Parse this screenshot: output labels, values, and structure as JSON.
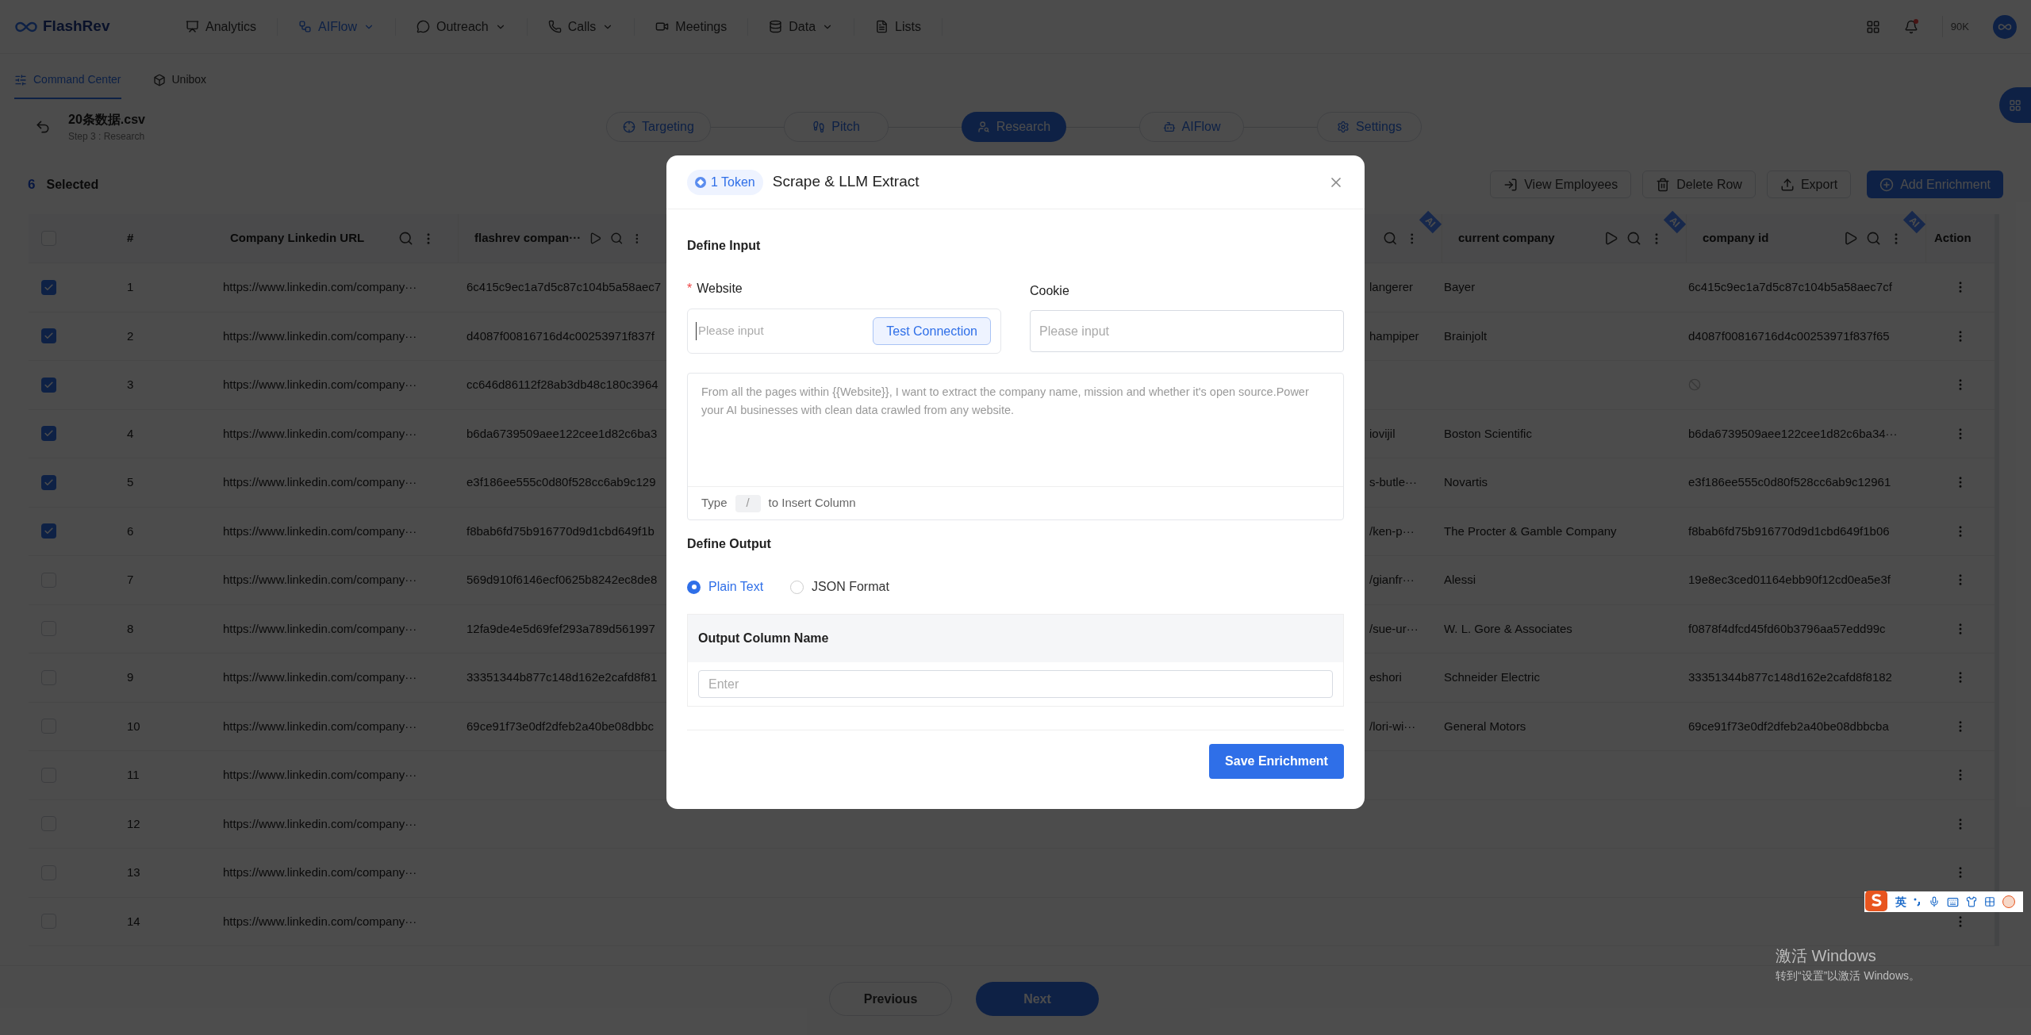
{
  "top_nav": {
    "logo": "FlashRev",
    "items": [
      {
        "label": "Analytics",
        "selected": false,
        "dropdown": false,
        "kind": "analytics"
      },
      {
        "label": "AIFlow",
        "selected": true,
        "dropdown": true,
        "kind": "aiflow"
      },
      {
        "label": "Outreach",
        "selected": false,
        "dropdown": true,
        "kind": "outreach"
      },
      {
        "label": "Calls",
        "selected": false,
        "dropdown": true,
        "kind": "calls"
      },
      {
        "label": "Meetings",
        "selected": false,
        "dropdown": false,
        "kind": "meetings"
      },
      {
        "label": "Data",
        "selected": false,
        "dropdown": true,
        "kind": "data"
      },
      {
        "label": "Lists",
        "selected": false,
        "dropdown": false,
        "kind": "lists"
      }
    ],
    "notifications": true,
    "credits": "90K"
  },
  "sub_tabs": [
    {
      "label": "Command Center",
      "selected": true,
      "kind": "command"
    },
    {
      "label": "Unibox",
      "selected": false,
      "kind": "unibox"
    }
  ],
  "file": {
    "name": "20条数据.csv",
    "step": "Step 3 : Research"
  },
  "steps": [
    {
      "label": "Targeting",
      "selected": false,
      "kind": "targeting"
    },
    {
      "label": "Pitch",
      "selected": false,
      "kind": "pitch"
    },
    {
      "label": "Research",
      "selected": true,
      "kind": "research"
    },
    {
      "label": "AIFlow",
      "selected": false,
      "kind": "aiflow"
    },
    {
      "label": "Settings",
      "selected": false,
      "kind": "settings"
    }
  ],
  "selection": {
    "count": "6",
    "label": "Selected"
  },
  "toolbar": [
    {
      "label": "View Employees",
      "kind": "employees"
    },
    {
      "label": "Delete Row",
      "kind": "delete"
    },
    {
      "label": "Export",
      "kind": "export"
    },
    {
      "label": "Add Enrichment",
      "kind": "add"
    }
  ],
  "table": {
    "select_all": false,
    "columns": [
      {
        "kind": "index",
        "label": "#"
      },
      {
        "kind": "data",
        "label": "Company Linkedin URL",
        "runnable": false
      },
      {
        "kind": "data",
        "label": "flashrev compan···",
        "runnable": true
      },
      {
        "kind": "data",
        "runnable": false,
        "badge": "AI"
      },
      {
        "kind": "data",
        "label": "current company",
        "runnable": true,
        "badge": "AI"
      },
      {
        "kind": "data",
        "label": "company id",
        "runnable": true,
        "badge": "AI"
      },
      {
        "kind": "action",
        "label": "Action"
      }
    ],
    "rows": [
      {
        "checked": true,
        "index": "1",
        "url": "https://www.linkedin.com/company···",
        "flashrev_id": "6c415c9ec1a7d5c87c104b5a58aec7",
        "column_5": "langerer",
        "company": "Bayer",
        "company_id": "6c415c9ec1a7d5c87c104b5a58aec7cf"
      },
      {
        "checked": true,
        "index": "2",
        "url": "https://www.linkedin.com/company···",
        "flashrev_id": "d4087f00816716d4c00253971f837f",
        "column_5": "hampiper",
        "company": "Brainjolt",
        "company_id": "d4087f00816716d4c00253971f837f65"
      },
      {
        "checked": true,
        "index": "3",
        "url": "https://www.linkedin.com/company···",
        "flashrev_id": "cc646d86112f28ab3db48c180c3964",
        "company_id": null
      },
      {
        "checked": true,
        "index": "4",
        "url": "https://www.linkedin.com/company···",
        "flashrev_id": "b6da6739509aee122cee1d82c6ba3",
        "column_5": "iovijil",
        "company": "Boston Scientific",
        "company_id": "b6da6739509aee122cee1d82c6ba34···"
      },
      {
        "checked": true,
        "index": "5",
        "url": "https://www.linkedin.com/company···",
        "flashrev_id": "e3f186ee555c0d80f528cc6ab9c129",
        "column_5": "s-butle···",
        "company": "Novartis",
        "company_id": "e3f186ee555c0d80f528cc6ab9c12961"
      },
      {
        "checked": true,
        "index": "6",
        "url": "https://www.linkedin.com/company···",
        "flashrev_id": "f8bab6fd75b916770d9d1cbd649f1b",
        "column_5": "/ken-p···",
        "company": "The Procter & Gamble Company",
        "company_id": "f8bab6fd75b916770d9d1cbd649f1b06"
      },
      {
        "checked": false,
        "index": "7",
        "url": "https://www.linkedin.com/company···",
        "flashrev_id": "569d910f6146ecf0625b8242ec8de8",
        "column_5": "/gianfr···",
        "company": "Alessi",
        "company_id": "19e8ec3ced01164ebb90f12cd0ea5e3f"
      },
      {
        "checked": false,
        "index": "8",
        "url": "https://www.linkedin.com/company···",
        "flashrev_id": "12fa9de4e5d69fef293a789d561997",
        "column_5": "/sue-ur···",
        "company": "W. L. Gore & Associates",
        "company_id": "f0878f4dfcd45fd60b3796aa57edd99c"
      },
      {
        "checked": false,
        "index": "9",
        "url": "https://www.linkedin.com/company···",
        "flashrev_id": "33351344b877c148d162e2cafd8f81",
        "column_5": "eshori",
        "company": "Schneider Electric",
        "company_id": "33351344b877c148d162e2cafd8f8182"
      },
      {
        "checked": false,
        "index": "10",
        "url": "https://www.linkedin.com/company···",
        "flashrev_id": "69ce91f73e0df2dfeb2a40be08dbbc",
        "column_5": "/lori-wi···",
        "company": "General Motors",
        "company_id": "69ce91f73e0df2dfeb2a40be08dbbcba"
      },
      {
        "checked": false,
        "index": "11",
        "url": "https://www.linkedin.com/company···"
      },
      {
        "checked": false,
        "index": "12",
        "url": "https://www.linkedin.com/company···"
      },
      {
        "checked": false,
        "index": "13",
        "url": "https://www.linkedin.com/company···"
      },
      {
        "checked": false,
        "index": "14",
        "url": "https://www.linkedin.com/company···"
      }
    ]
  },
  "pagination": {
    "previous": "Previous",
    "next": "Next"
  },
  "modal": {
    "token": "1 Token",
    "title": "Scrape & LLM Extract",
    "input_section": "Define Input",
    "required_mark": "*",
    "website": {
      "label": "Website",
      "required": true,
      "placeholder": "Please input",
      "button": "Test Connection"
    },
    "cookie": {
      "label": "Cookie",
      "required": false,
      "placeholder": "Please input"
    },
    "prompt": {
      "placeholder": "From all the pages within {{Website}}, I want to extract the company name, mission and whether it's open source.Power your AI businesses with clean data crawled from any website.",
      "hint_before": "Type",
      "hint_key": "/",
      "hint_after": "to Insert Column"
    },
    "output_section": "Define Output",
    "formats": [
      {
        "label": "Plain Text",
        "selected": true
      },
      {
        "label": "JSON Format",
        "selected": false
      }
    ],
    "output_column": {
      "label": "Output Column Name",
      "placeholder": "Enter"
    },
    "save": "Save Enrichment"
  },
  "ime_bar": {
    "mode": "英"
  },
  "os_notice": {
    "title": "激活 Windows",
    "subtitle": "转到“设置”以激活 Windows。"
  }
}
